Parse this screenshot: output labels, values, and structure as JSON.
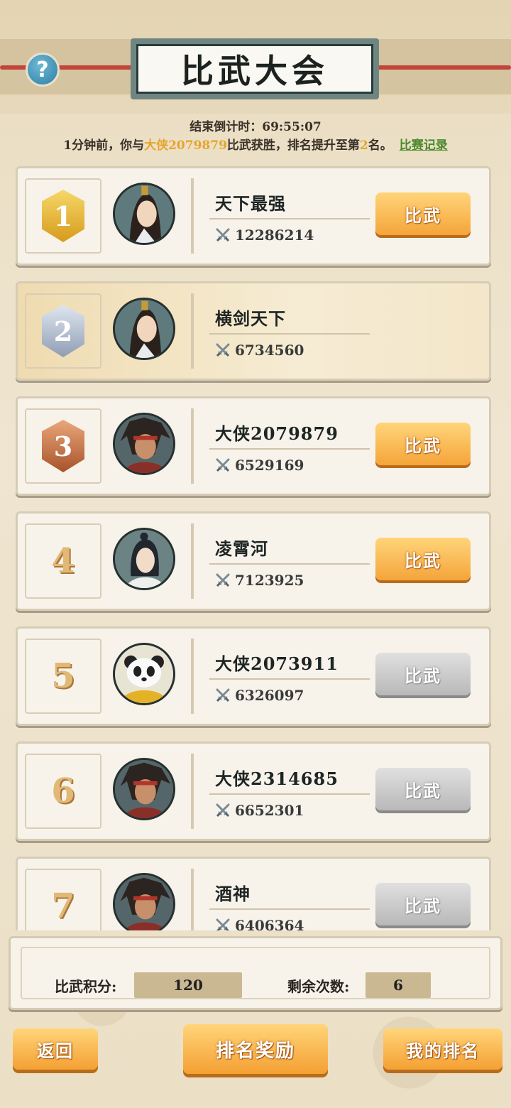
{
  "title": "比武大会",
  "help_icon": "question-icon",
  "countdown_text": "结束倒计时：69:55:07",
  "notice": {
    "prefix": "1分钟前，你与",
    "opponent": "大侠2079879",
    "middle": "比武获胜，排名提升至第",
    "rank": "2",
    "suffix": "名。",
    "link": "比赛记录"
  },
  "fight_label": "比武",
  "players": [
    {
      "rank": "1",
      "name": "天下最强",
      "power": "12286214",
      "medal": "gold",
      "avatar": "swordsman",
      "button": "active"
    },
    {
      "rank": "2",
      "name": "横剑天下",
      "power": "6734560",
      "medal": "silver",
      "avatar": "swordsman",
      "button": "none",
      "is_self": true
    },
    {
      "rank": "3",
      "name": "大侠2079879",
      "power": "6529169",
      "medal": "bronze",
      "avatar": "warrior",
      "button": "active"
    },
    {
      "rank": "4",
      "name": "凌霄河",
      "power": "7123925",
      "medal": "none",
      "avatar": "scholar",
      "button": "active"
    },
    {
      "rank": "5",
      "name": "大侠2073911",
      "power": "6326097",
      "medal": "none",
      "avatar": "panda",
      "button": "disabled"
    },
    {
      "rank": "6",
      "name": "大侠2314685",
      "power": "6652301",
      "medal": "none",
      "avatar": "warrior",
      "button": "disabled"
    },
    {
      "rank": "7",
      "name": "酒神",
      "power": "6406364",
      "medal": "none",
      "avatar": "warrior",
      "button": "disabled"
    }
  ],
  "stats": {
    "score_label": "比武积分:",
    "score_value": "120",
    "remaining_label": "剩余次数:",
    "remaining_value": "6"
  },
  "buttons": {
    "back": "返回",
    "rank_reward": "排名奖励",
    "my_rank": "我的排名"
  },
  "colors": {
    "gold": "#e8b92e",
    "silver": "#a9b4c4",
    "bronze": "#c4754a",
    "highlight": "#e6a52a",
    "link": "#4a8a2b"
  }
}
